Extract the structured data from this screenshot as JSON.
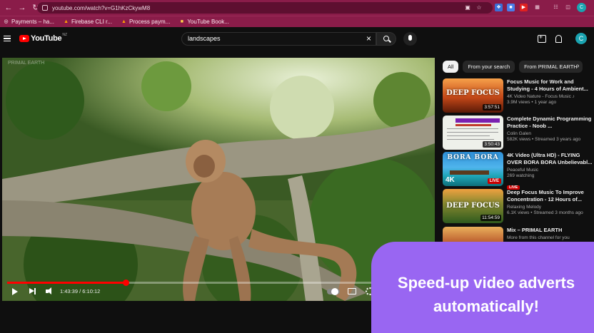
{
  "browser": {
    "url": "youtube.com/watch?v=G1hKzCkywM8",
    "profile_initial": "C",
    "bookmarks": [
      {
        "label": "Payments – ha...",
        "icon": "globe-icon"
      },
      {
        "label": "Firebase CLI r...",
        "icon": "firebase-icon"
      },
      {
        "label": "Process paym...",
        "icon": "firebase-icon"
      },
      {
        "label": "YouTube Book...",
        "icon": "bookmark-icon"
      }
    ]
  },
  "header": {
    "logo_text": "YouTube",
    "logo_country": "NZ",
    "search_query": "landscapes",
    "avatar_initial": "C"
  },
  "player": {
    "current_time": "1:43:39",
    "duration": "6:10:12",
    "progress": 0.28,
    "watermark": "PRIMAL EARTH"
  },
  "chips": [
    {
      "label": "All",
      "active": true
    },
    {
      "label": "From your search",
      "active": false
    },
    {
      "label": "From PRIMAL EARTH",
      "active": false
    }
  ],
  "recommendations": [
    {
      "title": "Focus Music for Work and Studying - 4 Hours of Ambient...",
      "channel": "4K Video Nature - Focus Music ♪",
      "meta": "3.9M views • 1 year ago",
      "duration": "3:57:51",
      "thumb_text": "DEEP FOCUS"
    },
    {
      "title": "Complete Dynamic Programming Practice - Noob ...",
      "channel": "Colin Galen",
      "meta": "582K views • Streamed 3 years ago",
      "duration": "3:50:43",
      "thumb_text": ""
    },
    {
      "title": "4K Video (Ultra HD) - FLYING OVER BORA BORA Unbelievabl...",
      "channel": "Peaceful Music",
      "meta": "269 watching",
      "badge": "LIVE",
      "thumb_text": "BORA BORA"
    },
    {
      "title": "Deep Focus Music To Improve Concentration - 12 Hours of...",
      "channel": "Relaxing Melody",
      "meta": "6.1K views • Streamed 3 months ago",
      "duration": "11:54:59",
      "thumb_text": "DEEP FOCUS"
    },
    {
      "title": "Mix – PRIMAL EARTH",
      "channel": "More from this channel for you",
      "meta": "",
      "thumb_text": ""
    }
  ],
  "promo": {
    "line1": "Speed-up video adverts",
    "line2": "automatically!",
    "color": "#9966f2"
  },
  "colors": {
    "browser_accent": "#8a1c49",
    "yt_red": "#ff0000",
    "background": "#0f0f0f"
  }
}
